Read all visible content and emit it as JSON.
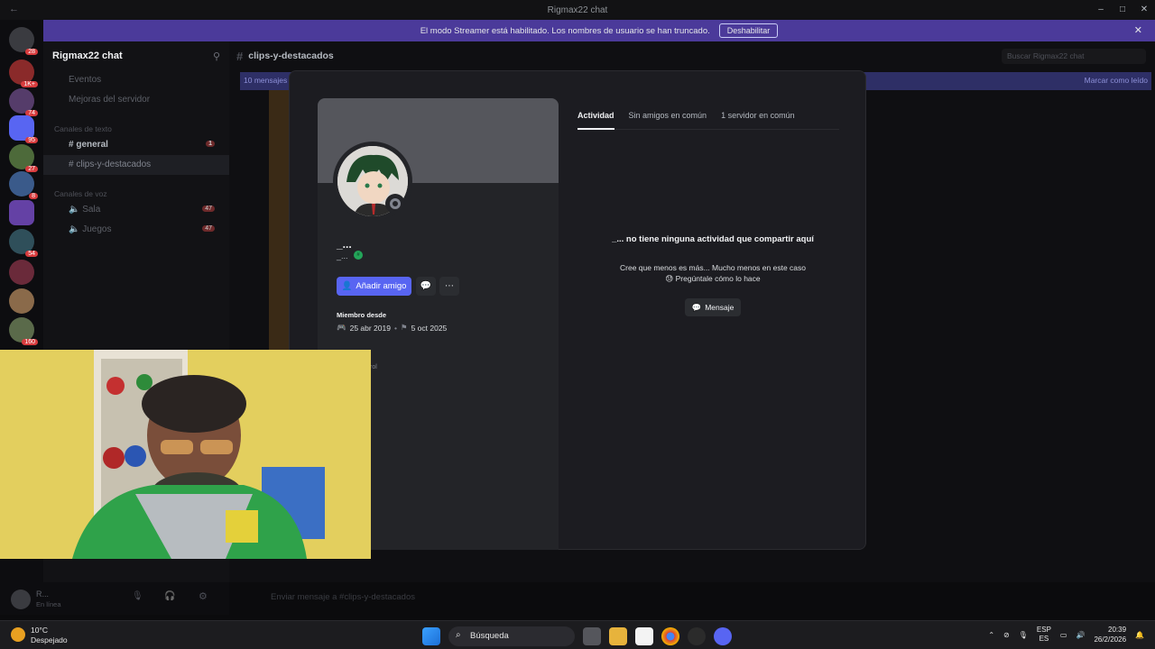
{
  "window": {
    "title": "Rigmax22 chat",
    "controls": [
      "–",
      "□",
      "✕"
    ]
  },
  "banner": {
    "text": "El modo Streamer está habilitado. Los nombres de usuario se han truncado.",
    "button": "Deshabilitar"
  },
  "servers": [
    {
      "badge": "28"
    },
    {
      "badge": "1K+"
    },
    {
      "badge": "74"
    },
    {
      "badge": "95"
    },
    {
      "badge": "27"
    },
    {
      "badge": "8"
    },
    {
      "badge": ""
    },
    {
      "badge": "54"
    },
    {
      "badge": ""
    },
    {
      "badge": ""
    },
    {
      "badge": "160"
    }
  ],
  "sidebar": {
    "server_name": "Rigmax22 chat",
    "items": [
      {
        "label": "Eventos"
      },
      {
        "label": "Mejoras del servidor"
      }
    ],
    "text_category": "Canales de texto",
    "text_channels": [
      {
        "label": "general",
        "badge": "1"
      },
      {
        "label": "clips-y-destacados",
        "badge": ""
      }
    ],
    "voice_category": "Canales de voz",
    "voice_channels": [
      {
        "label": "Sala",
        "badge": "47"
      },
      {
        "label": "Juegos",
        "badge": "47"
      }
    ]
  },
  "user_panel": {
    "name": "R...",
    "status": "En línea"
  },
  "chat": {
    "channel": "clips-y-destacados",
    "new_messages": "10 mensajes",
    "mark_read": "Marcar como leído",
    "search_placeholder": "Buscar Rigmax22 chat",
    "input_placeholder": "Enviar mensaje a #clips-y-destacados"
  },
  "profile": {
    "display_name": "_...",
    "username": "_...",
    "add_friend": "Añadir amigo",
    "member_since_label": "Miembro desde",
    "discord_date": "25 abr 2019",
    "server_date": "5 oct 2025",
    "tabs": [
      {
        "label": "Actividad",
        "active": true
      },
      {
        "label": "Sin amigos en común",
        "active": false
      },
      {
        "label": "1 servidor en común",
        "active": false
      }
    ],
    "empty_title": "_... no tiene ninguna actividad que compartir aquí",
    "empty_desc_1": "Cree que menos es más... Mucho menos en este caso",
    "empty_desc_2": "Pregúntale cómo lo hace",
    "message_button": "Mensaje",
    "role_fragment": "rol"
  },
  "taskbar": {
    "temp": "10°C",
    "weather": "Despejado",
    "search": "Búsqueda",
    "lang_top": "ESP",
    "lang_bottom": "ES",
    "time": "20:39",
    "date": "26/2/2026"
  },
  "colors": {
    "accent": "#5865f2",
    "banner": "#4b3a9a",
    "online": "#23a559",
    "badge": "#d83c3e"
  }
}
